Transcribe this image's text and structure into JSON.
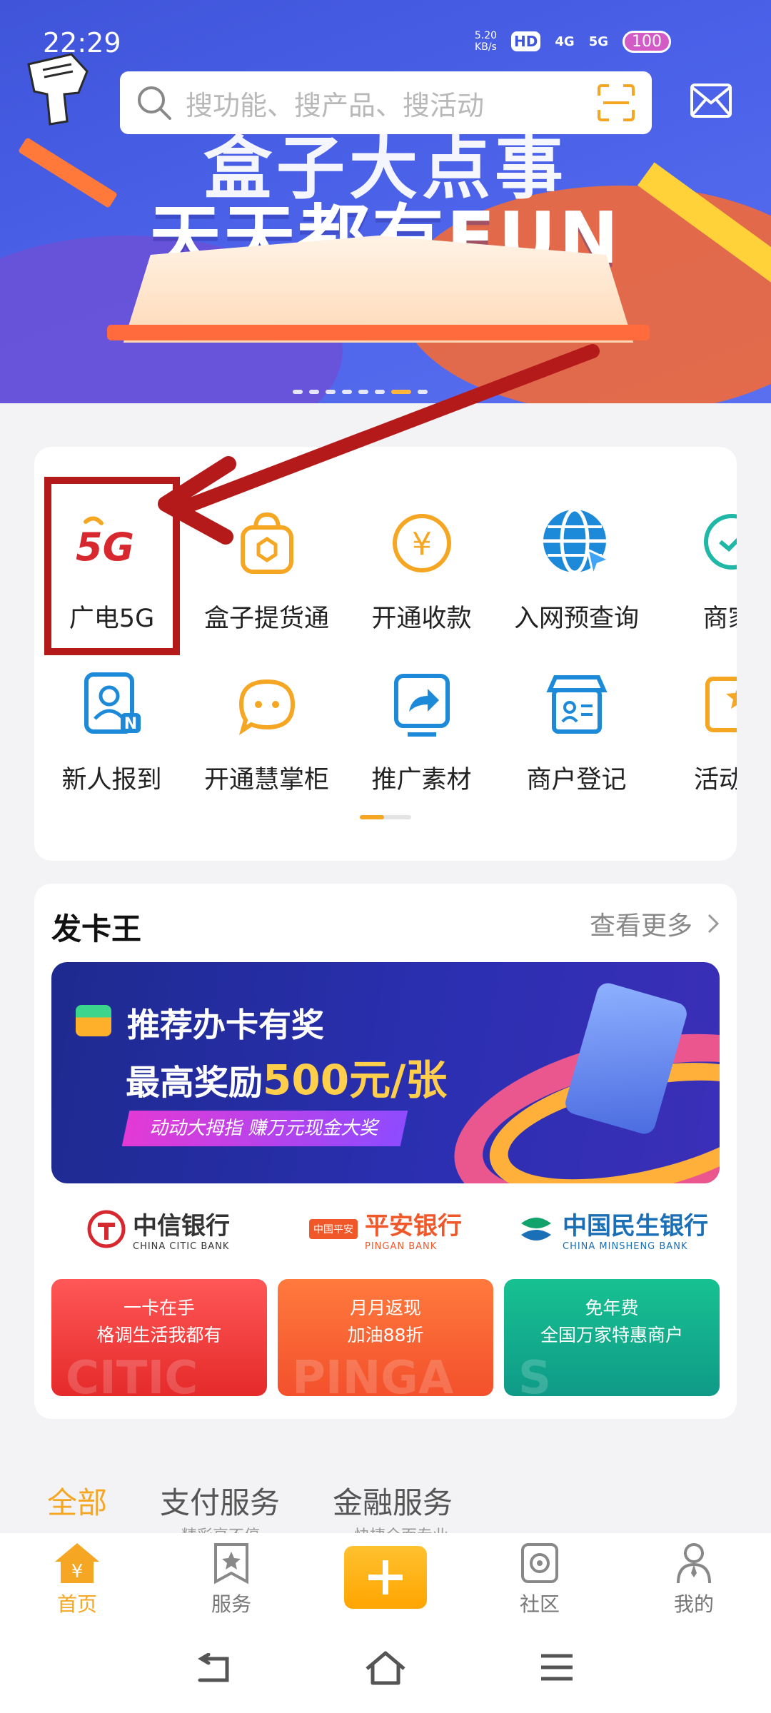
{
  "status_bar": {
    "time": "22:29",
    "net_speed_value": "5.20",
    "net_speed_unit": "KB/s",
    "hd_label": "HD",
    "signal_1": "4G",
    "signal_2": "5G",
    "battery": "100"
  },
  "banner": {
    "headline_top": "盒子大点事",
    "headline_main": "天天都有FUN"
  },
  "search": {
    "placeholder": "搜功能、搜产品、搜活动"
  },
  "functions": {
    "row1": [
      {
        "label": "广电5G",
        "icon": "5g-icon"
      },
      {
        "label": "盒子提货通",
        "icon": "shopping-bag-icon"
      },
      {
        "label": "开通收款",
        "icon": "yuan-coin-icon"
      },
      {
        "label": "入网预查询",
        "icon": "globe-icon"
      },
      {
        "label": "商家i",
        "icon": "chat-check-icon"
      }
    ],
    "row2": [
      {
        "label": "新人报到",
        "icon": "new-user-icon"
      },
      {
        "label": "开通慧掌柜",
        "icon": "smile-bubble-icon"
      },
      {
        "label": "推广素材",
        "icon": "share-screen-icon"
      },
      {
        "label": "商户登记",
        "icon": "store-icon"
      },
      {
        "label": "活动专",
        "icon": "star-card-icon"
      }
    ]
  },
  "card_king": {
    "title": "发卡王",
    "more": "查看更多",
    "banner_line1": "推荐办卡有奖",
    "banner_line2_prefix": "最高奖励",
    "banner_line2_highlight": "500元/张",
    "banner_tag": "动动大拇指 赚万元现金大奖",
    "banks": [
      {
        "name_cn": "中信银行",
        "name_en": "CHINA CITIC BANK",
        "color": "#d7282f",
        "badge": "",
        "card_line1": "一卡在手",
        "card_line2": "格调生活我都有",
        "watermark": "CITIC"
      },
      {
        "name_cn": "平安银行",
        "name_en": "PINGAN BANK",
        "color": "#f0582a",
        "badge": "中国平安",
        "card_line1": "月月返现",
        "card_line2": "加油88折",
        "watermark": "PINGA"
      },
      {
        "name_cn": "中国民生银行",
        "name_en": "CHINA MINSHENG BANK",
        "color": "#1a6fb7",
        "badge": "",
        "card_line1": "免年费",
        "card_line2": "全国万家特惠商户",
        "watermark": "S"
      }
    ]
  },
  "categories": {
    "tabs": [
      "全部",
      "支付服务",
      "金融服务"
    ],
    "subs": [
      "精彩享不停",
      "快捷全面专业"
    ]
  },
  "bottom_nav": {
    "items": [
      "首页",
      "服务",
      "社区",
      "我的"
    ],
    "active": "首页"
  },
  "colors": {
    "accent": "#f5a623",
    "highlight_red": "#b51a1a",
    "banner_blue": "#4a61e8"
  }
}
